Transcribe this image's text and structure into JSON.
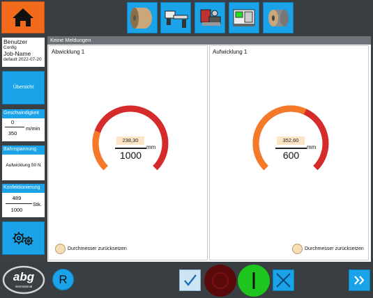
{
  "header": {
    "home_icon": "home-icon",
    "tools": [
      {
        "name": "roll-unwinder-icon"
      },
      {
        "name": "web-guide-icon"
      },
      {
        "name": "cutter-module-icon"
      },
      {
        "name": "converting-module-icon"
      },
      {
        "name": "rewinder-icon"
      }
    ]
  },
  "sidebar": {
    "user": {
      "line1": "Benutzer",
      "line2": "Config",
      "line3": "Job-Name",
      "line4": "default 2022-07-20"
    },
    "overview_label": "Übersicht",
    "speed": {
      "title": "Geschwindigkeit",
      "current": "0",
      "target": "350",
      "unit": "m/min"
    },
    "tension": {
      "title": "Bahnspannung",
      "value": "Aufwicklung 50 N"
    },
    "confection": {
      "title": "Konfektionierung",
      "current": "489",
      "target": "1000",
      "unit": "Stk."
    },
    "settings_icon": "gears-icon"
  },
  "main": {
    "message": "Keine Meldungen",
    "unwind": {
      "title": "Abwicklung 1",
      "current": "238,30",
      "max": "1000",
      "unit": "mm",
      "reset_label": "Durchmesser zurücksetzen",
      "fraction": 0.24
    },
    "rewind": {
      "title": "Aufwicklung 1",
      "current": "352,60",
      "max": "600",
      "unit": "mm",
      "reset_label": "Durchmesser zurücksetzen",
      "fraction": 0.59
    }
  },
  "footer": {
    "logo_text": "abg",
    "logo_sub": "international",
    "r_label": "R",
    "colors": {
      "orange": "#f26b1d",
      "blue": "#1aa3e8",
      "red": "#d62b2b",
      "green": "#1ec51e",
      "dark_red": "#5a0a0a"
    }
  }
}
